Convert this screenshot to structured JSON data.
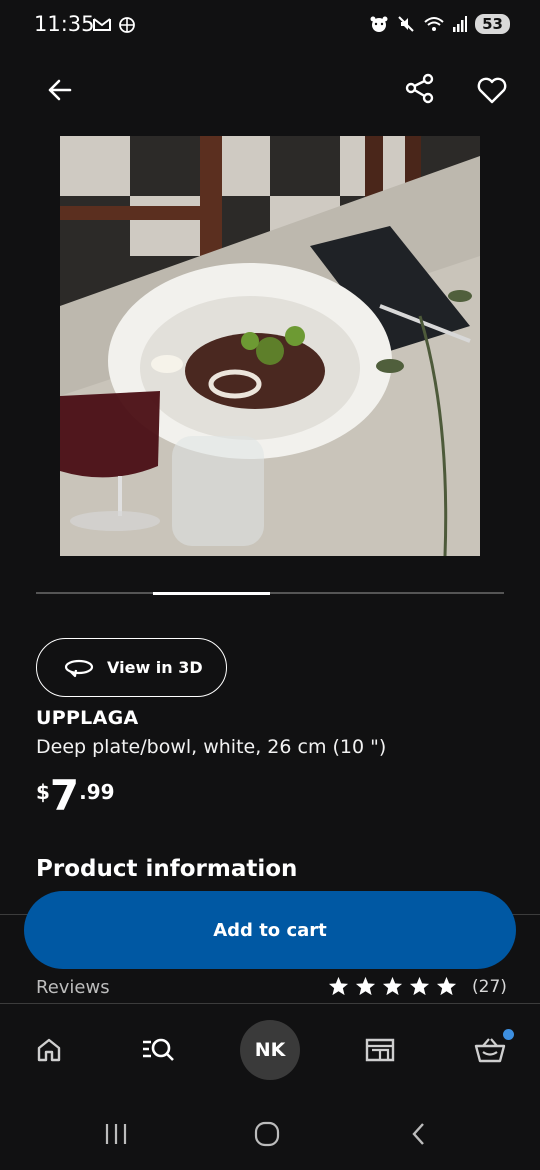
{
  "status_bar": {
    "time": "11:35",
    "battery": "53"
  },
  "header": {
    "back_icon": "arrow-left-icon",
    "share_icon": "share-icon",
    "favorite_icon": "heart-icon"
  },
  "carousel": {
    "segments": 4,
    "active_index": 1
  },
  "product": {
    "view_3d_label": "View in 3D",
    "name": "UPPLAGA",
    "description": "Deep plate/bowl, white, 26 cm (10 \")",
    "price_currency": "$",
    "price_integer": "7",
    "price_decimal": ".99"
  },
  "sections": {
    "product_information": "Product information",
    "reviews": "Reviews",
    "reviews_count": "(27)",
    "rating_stars": 5
  },
  "actions": {
    "add_to_cart": "Add to cart"
  },
  "bottom_nav": {
    "avatar_initials": "NK",
    "items": [
      "home-icon",
      "search-list-icon",
      "avatar",
      "store-icon",
      "basket-icon"
    ]
  },
  "colors": {
    "background": "#111112",
    "primary_button": "#0058a3",
    "notification_dot": "#3d8fe0"
  }
}
